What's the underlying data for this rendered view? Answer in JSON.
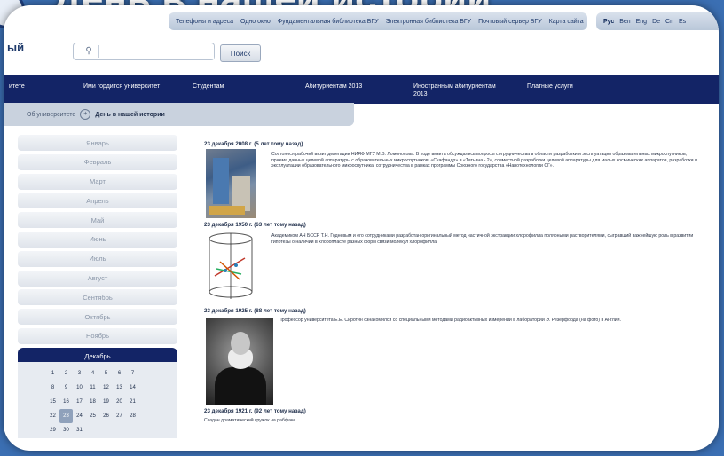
{
  "slide": {
    "title": "День в нашей истории"
  },
  "top_links": [
    "Телефоны и адреса",
    "Одно окно",
    "Фундаментальная библиотека БГУ",
    "Электронная библиотека БГУ",
    "Почтовый сервер БГУ",
    "Карта сайта"
  ],
  "languages": [
    "Рус",
    "Бел",
    "Eng",
    "De",
    "Cn",
    "Es"
  ],
  "logo_fragment": "ый",
  "search": {
    "button_label": "Поиск",
    "value": "",
    "placeholder": ""
  },
  "nav": {
    "items": [
      {
        "label": "итете"
      },
      {
        "label": "Ими гордится университет"
      },
      {
        "label": "Студентам"
      },
      {
        "label": "Абитуриентам 2013"
      },
      {
        "label": "Иностранным абитуриентам 2013"
      },
      {
        "label": "Платные услуги"
      }
    ]
  },
  "breadcrumb": {
    "root": "Об университете",
    "separator": "+",
    "current": "День в нашей истории"
  },
  "months": [
    "Январь",
    "Февраль",
    "Март",
    "Апрель",
    "Май",
    "Июнь",
    "Июль",
    "Август",
    "Сентябрь",
    "Октябрь",
    "Ноябрь",
    "Декабрь"
  ],
  "selected_month": "Декабрь",
  "calendar": {
    "days": [
      "1",
      "2",
      "3",
      "4",
      "5",
      "6",
      "7",
      "8",
      "9",
      "10",
      "11",
      "12",
      "13",
      "14",
      "15",
      "16",
      "17",
      "18",
      "19",
      "20",
      "21",
      "22",
      "23",
      "24",
      "25",
      "26",
      "27",
      "28",
      "29",
      "30",
      "31"
    ],
    "selected_day": "23"
  },
  "entries": [
    {
      "date": "23 декабря 2008 г. (5 лет тому назад)",
      "text": "Состоялся рабочий визит делегации НИЯФ МГУ М.В. Ломоносова. В ходе визита обсуждались вопросы сотрудничества в области разработки и эксплуатации образовательных микроспутников, приема данных целевой аппаратуры с образовательных микроспутников: «Скафандр» и «Татьяна - 2», совместной разработки целевой аппаратуры для малых космических аппаратов, разработки и эксплуатации образовательного микроспутника, сотрудничества в рамках программы Союзного государства «Нанотехнологии СГ»."
    },
    {
      "date": "23 декабря 1950 г. (63 лет тому назад)",
      "text": "Академиком АН БССР Т.Н. Годневым и его сотрудниками разработан оригинальный метод частичной экстракции хлорофилла полярными растворителями, сыгравший важнейшую роль в развитии гипотезы о наличии в хлоропласте разных форм связи молекул хлорофилла."
    },
    {
      "date": "23 декабря 1925 г. (88 лет тому назад)",
      "text": "Профессор университета Е.Е. Сиротин ознакомился со специальными методами радиоактивных измерений в лаборатории Э. Резерфорда (на фото) в Англии."
    },
    {
      "date": "23 декабря 1921 г. (92 лет тому назад)",
      "text": "Создан драматический кружок на рабфаке."
    }
  ]
}
